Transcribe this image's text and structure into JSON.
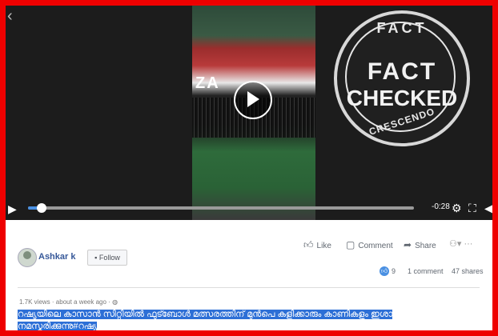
{
  "video": {
    "overlay_text": "ZA",
    "time_remaining": "-0:28",
    "progress_fraction": 0.035,
    "stamp": {
      "top": "FACT",
      "line1": "FACT",
      "line2": "CHECKED",
      "bottom": "CRESCENDO"
    }
  },
  "post": {
    "author": "Ashkar k",
    "follow_label": "Follow",
    "like_label": "Like",
    "comment_label": "Comment",
    "share_label": "Share",
    "reactions_count": "9",
    "comments_count": "1 comment",
    "shares_count": "47 shares",
    "meta": "1.7K views · about a week ago ·",
    "caption": "റഷ്യയിലെ കാസാൻ സിറ്റിയിൽ ഫുട്ബോൾ മത്സരത്തിന് മുൻപെ കളിക്കാരും കാണികളും ഇശാ നമസ്കരിക്കുന്നു#റഷ്യ"
  },
  "colors": {
    "frame": "#e00000",
    "accent": "#4a90e2",
    "link": "#365899"
  },
  "icons": [
    "back-icon",
    "play-icon",
    "settings-icon",
    "fullscreen-icon",
    "volume-icon",
    "like-icon",
    "comment-icon",
    "share-icon",
    "globe-icon"
  ]
}
